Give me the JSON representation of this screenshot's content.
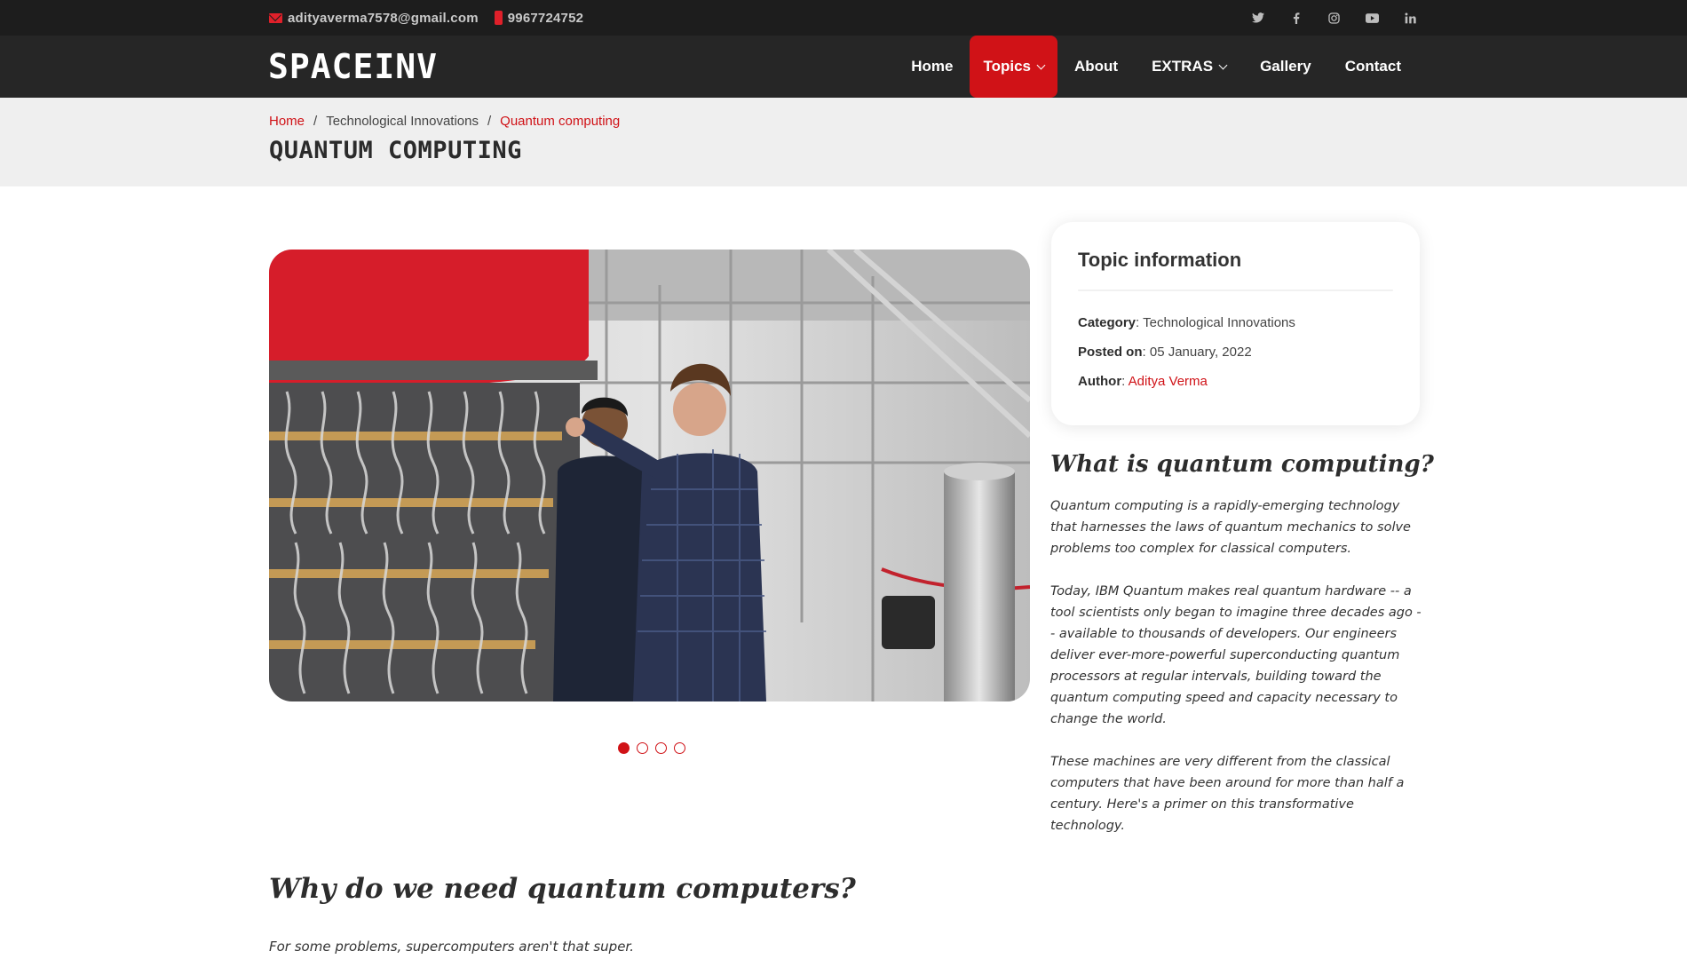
{
  "topbar": {
    "email": "adityaverma7578@gmail.com",
    "phone": "9967724752",
    "social": [
      "twitter-icon",
      "facebook-icon",
      "instagram-icon",
      "youtube-icon",
      "linkedin-icon"
    ]
  },
  "header": {
    "logo": "SPACEINV",
    "nav": {
      "home": "Home",
      "topics": "Topics",
      "about": "About",
      "extras": "EXTRAS",
      "gallery": "Gallery",
      "contact": "Contact"
    }
  },
  "breadcrumb": {
    "home": "Home",
    "sep": "/",
    "category": "Technological Innovations",
    "current": "Quantum computing"
  },
  "page_title": "QUANTUM COMPUTING",
  "carousel": {
    "slides": 4,
    "active": 1
  },
  "topic_info": {
    "title": "Topic information",
    "category_label": "Category",
    "category": "Technological Innovations",
    "posted_label": "Posted on",
    "posted": "05 January, 2022",
    "author_label": "Author",
    "author": "Aditya Verma"
  },
  "side": {
    "heading": "What is quantum computing?",
    "p1": "Quantum computing is a rapidly-emerging technology that harnesses the laws of quantum mechanics to solve problems too complex for classical computers.",
    "p2": "Today, IBM Quantum makes real quantum hardware -- a tool scientists only began to imagine three decades ago -- available to thousands of developers. Our engineers deliver ever-more-powerful superconducting quantum processors at regular intervals, building toward the quantum computing speed and capacity necessary to change the world.",
    "p3": "These machines are very different from the classical computers that have been around for more than half a century. Here's a primer on this transformative technology."
  },
  "main": {
    "heading": "Why do we need quantum computers?",
    "lead": "For some problems, supercomputers aren't that super."
  },
  "colors": {
    "accent": "#d01217",
    "topbar": "#1d1d1d",
    "header": "#262626",
    "band": "#efefef"
  }
}
